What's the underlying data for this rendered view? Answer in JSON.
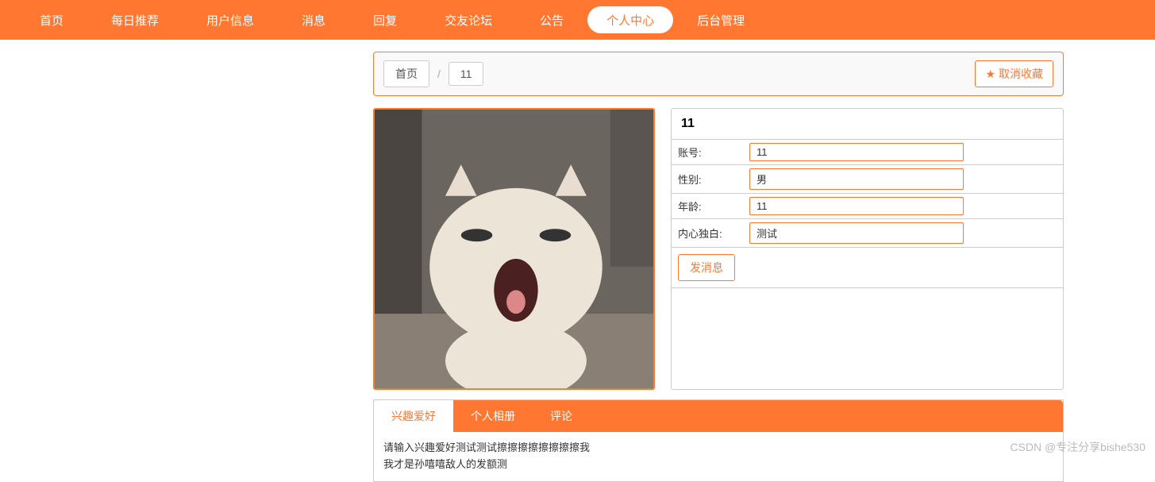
{
  "nav": {
    "items": [
      {
        "label": "首页",
        "active": false
      },
      {
        "label": "每日推荐",
        "active": false
      },
      {
        "label": "用户信息",
        "active": false
      },
      {
        "label": "消息",
        "active": false
      },
      {
        "label": "回复",
        "active": false
      },
      {
        "label": "交友论坛",
        "active": false
      },
      {
        "label": "公告",
        "active": false
      },
      {
        "label": "个人中心",
        "active": true
      },
      {
        "label": "后台管理",
        "active": false
      }
    ]
  },
  "breadcrumb": {
    "home": "首页",
    "current": "11"
  },
  "favorite": {
    "label": "取消收藏",
    "icon": "★"
  },
  "profile": {
    "title": "11",
    "fields": [
      {
        "label": "账号:",
        "value": "11"
      },
      {
        "label": "性别:",
        "value": "男"
      },
      {
        "label": "年龄:",
        "value": "11"
      },
      {
        "label": "内心独白:",
        "value": "测试"
      }
    ],
    "message_btn": "发消息"
  },
  "tabs": {
    "items": [
      {
        "label": "兴趣爱好",
        "active": true
      },
      {
        "label": "个人相册",
        "active": false
      },
      {
        "label": "评论",
        "active": false
      }
    ],
    "content_line1": "请输入兴趣爱好测试测试擦擦擦擦擦擦擦擦我",
    "content_line2": "我才是孙嘻嘻敌人的发额测"
  },
  "watermark": "CSDN @专注分享bishe530"
}
